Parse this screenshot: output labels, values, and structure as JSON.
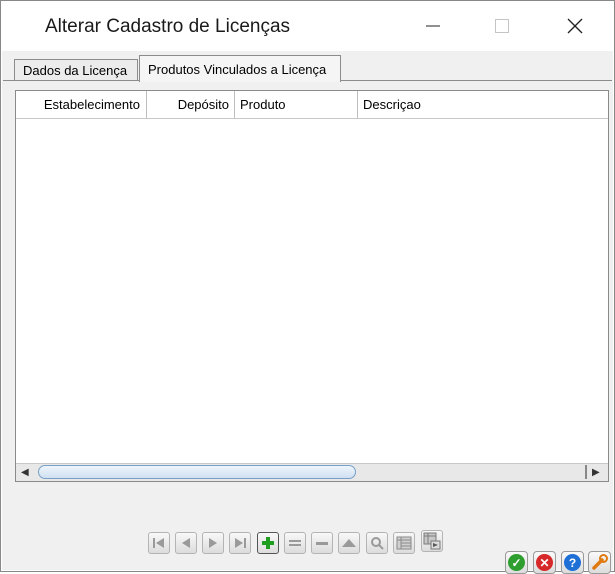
{
  "window": {
    "title": "Alterar Cadastro de Licenças"
  },
  "tabs": [
    {
      "label": "Dados da Licença",
      "active": false
    },
    {
      "label": "Produtos Vinculados a Licença",
      "active": true
    }
  ],
  "table": {
    "columns": [
      "Estabelecimento",
      "Depósito",
      "Produto",
      "Descriçao"
    ],
    "rows": []
  },
  "navigator": {
    "buttons": [
      "first-icon",
      "prior-icon",
      "next-icon",
      "last-icon",
      "insert-icon",
      "edit-icon",
      "delete-icon",
      "post-icon",
      "search-icon",
      "grid-icon",
      "export-icon"
    ]
  },
  "actions": {
    "icons": [
      "ok-icon",
      "cancel-icon",
      "help-icon",
      "tools-icon"
    ],
    "colors": {
      "ok": "#2e9e2e",
      "cancel": "#d62828",
      "help": "#1e6fd6",
      "tools": "#e07a10"
    }
  }
}
